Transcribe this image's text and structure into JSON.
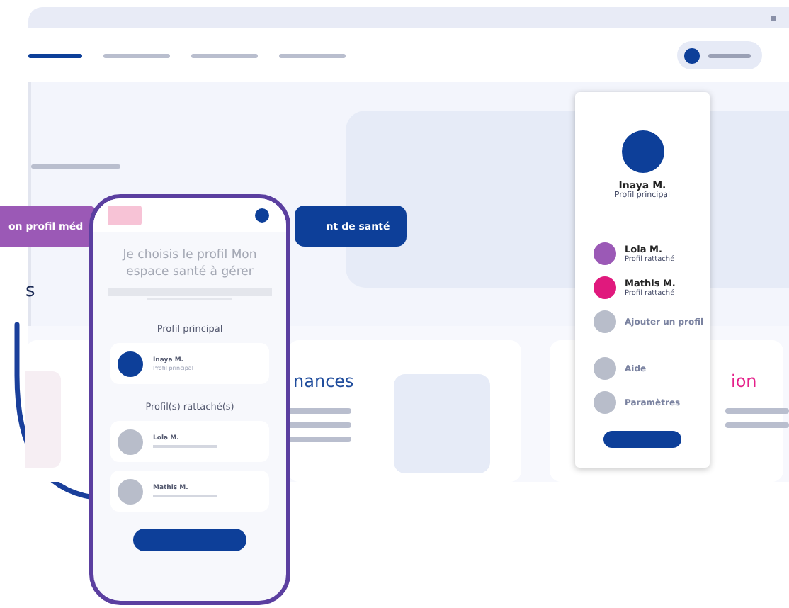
{
  "nav_tabs": [
    {
      "selected": true
    },
    {
      "selected": false
    },
    {
      "selected": false
    },
    {
      "selected": false
    }
  ],
  "hero": {
    "buttons": [
      {
        "label": "on profil méd",
        "kind": "secondary"
      },
      {
        "label": "nt de santé",
        "kind": "primary"
      }
    ],
    "section_title": "s"
  },
  "cards": [
    {
      "title": "nances",
      "color": "#1f4c9c"
    },
    {
      "title": "ion",
      "color": "#e5208a"
    }
  ],
  "profile_menu": {
    "user": {
      "name": "Inaya M.",
      "role": "Profil principal"
    },
    "items": [
      {
        "kind": "profile",
        "name": "Lola M.",
        "role": "Profil rattaché",
        "color": "#9b59b6"
      },
      {
        "kind": "profile",
        "name": "Mathis M.",
        "role": "Profil rattaché",
        "color": "#e0197d"
      },
      {
        "kind": "action",
        "label": "Ajouter un profil"
      },
      {
        "kind": "gap"
      },
      {
        "kind": "action",
        "label": "Aide"
      },
      {
        "kind": "action",
        "label": "Paramètres"
      }
    ]
  },
  "phone": {
    "heading": "Je choisis le profil Mon espace santé à gérer",
    "main_section": "Profil principal",
    "main_profiles": [
      {
        "name": "Inaya M.",
        "role": "Profil principal",
        "color": "#0d3f99"
      }
    ],
    "linked_section": "Profil(s) rattaché(s)",
    "linked_profiles": [
      {
        "name": "Lola M.",
        "color": "#b8bdca"
      },
      {
        "name": "Mathis M.",
        "color": "#b8bdca"
      }
    ]
  }
}
